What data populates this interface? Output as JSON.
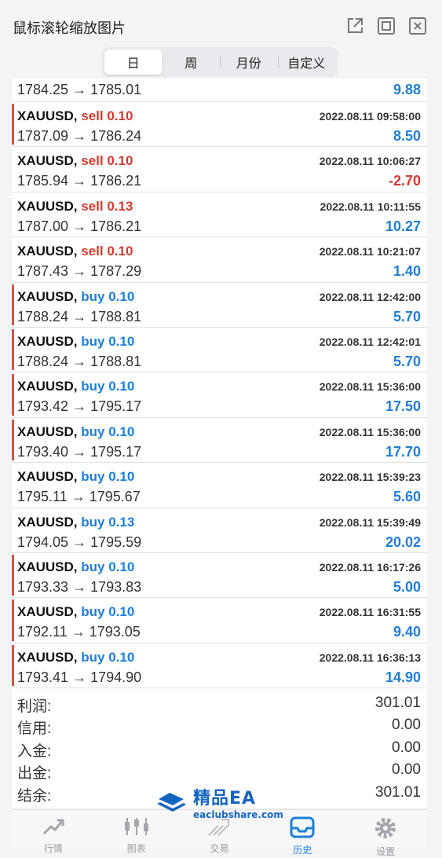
{
  "window": {
    "title": "鼠标滚轮缩放图片"
  },
  "tabs": [
    {
      "label": "日",
      "active": true
    },
    {
      "label": "周",
      "active": false
    },
    {
      "label": "月份",
      "active": false
    },
    {
      "label": "自定义",
      "active": false
    }
  ],
  "partial_row": {
    "prices": "1784.25 → 1785.01",
    "profit": "9.88"
  },
  "trades": [
    {
      "symbol": "XAUUSD,",
      "side": "sell 0.10",
      "type": "sell",
      "time": "2022.08.11 09:58:00",
      "prices": "1787.09 → 1786.24",
      "profit": "8.50",
      "positive": true,
      "marked": true
    },
    {
      "symbol": "XAUUSD,",
      "side": "sell 0.10",
      "type": "sell",
      "time": "2022.08.11 10:06:27",
      "prices": "1785.94 → 1786.21",
      "profit": "-2.70",
      "positive": false,
      "marked": false
    },
    {
      "symbol": "XAUUSD,",
      "side": "sell 0.13",
      "type": "sell",
      "time": "2022.08.11 10:11:55",
      "prices": "1787.00 → 1786.21",
      "profit": "10.27",
      "positive": true,
      "marked": false
    },
    {
      "symbol": "XAUUSD,",
      "side": "sell 0.10",
      "type": "sell",
      "time": "2022.08.11 10:21:07",
      "prices": "1787.43 → 1787.29",
      "profit": "1.40",
      "positive": true,
      "marked": false
    },
    {
      "symbol": "XAUUSD,",
      "side": "buy 0.10",
      "type": "buy",
      "time": "2022.08.11 12:42:00",
      "prices": "1788.24 → 1788.81",
      "profit": "5.70",
      "positive": true,
      "marked": true
    },
    {
      "symbol": "XAUUSD,",
      "side": "buy 0.10",
      "type": "buy",
      "time": "2022.08.11 12:42:01",
      "prices": "1788.24 → 1788.81",
      "profit": "5.70",
      "positive": true,
      "marked": true
    },
    {
      "symbol": "XAUUSD,",
      "side": "buy 0.10",
      "type": "buy",
      "time": "2022.08.11 15:36:00",
      "prices": "1793.42 → 1795.17",
      "profit": "17.50",
      "positive": true,
      "marked": true
    },
    {
      "symbol": "XAUUSD,",
      "side": "buy 0.10",
      "type": "buy",
      "time": "2022.08.11 15:36:00",
      "prices": "1793.40 → 1795.17",
      "profit": "17.70",
      "positive": true,
      "marked": true
    },
    {
      "symbol": "XAUUSD,",
      "side": "buy 0.10",
      "type": "buy",
      "time": "2022.08.11 15:39:23",
      "prices": "1795.11 → 1795.67",
      "profit": "5.60",
      "positive": true,
      "marked": false
    },
    {
      "symbol": "XAUUSD,",
      "side": "buy 0.13",
      "type": "buy",
      "time": "2022.08.11 15:39:49",
      "prices": "1794.05 → 1795.59",
      "profit": "20.02",
      "positive": true,
      "marked": false
    },
    {
      "symbol": "XAUUSD,",
      "side": "buy 0.10",
      "type": "buy",
      "time": "2022.08.11 16:17:26",
      "prices": "1793.33 → 1793.83",
      "profit": "5.00",
      "positive": true,
      "marked": true
    },
    {
      "symbol": "XAUUSD,",
      "side": "buy 0.10",
      "type": "buy",
      "time": "2022.08.11 16:31:55",
      "prices": "1792.11 → 1793.05",
      "profit": "9.40",
      "positive": true,
      "marked": true
    },
    {
      "symbol": "XAUUSD,",
      "side": "buy 0.10",
      "type": "buy",
      "time": "2022.08.11 16:36:13",
      "prices": "1793.41 → 1794.90",
      "profit": "14.90",
      "positive": true,
      "marked": true
    }
  ],
  "summary": [
    {
      "label": "利润:",
      "value": "301.01"
    },
    {
      "label": "信用:",
      "value": "0.00"
    },
    {
      "label": "入金:",
      "value": "0.00"
    },
    {
      "label": "出金:",
      "value": "0.00"
    },
    {
      "label": "结余:",
      "value": "301.01"
    }
  ],
  "watermark": {
    "title": "精品EA",
    "url": "eaclubshare.com"
  },
  "nav": [
    {
      "label": "行情",
      "icon": "quotes-icon",
      "active": false
    },
    {
      "label": "图表",
      "icon": "candlestick-icon",
      "active": false
    },
    {
      "label": "交易",
      "icon": "trade-icon",
      "active": false
    },
    {
      "label": "历史",
      "icon": "history-inbox-icon",
      "active": true
    },
    {
      "label": "设置",
      "icon": "gear-icon",
      "active": false
    }
  ],
  "colors": {
    "buy": "#1e7fd8",
    "sell": "#d23b2f",
    "marker": "#d0564a",
    "accent": "#1e7fd8"
  }
}
